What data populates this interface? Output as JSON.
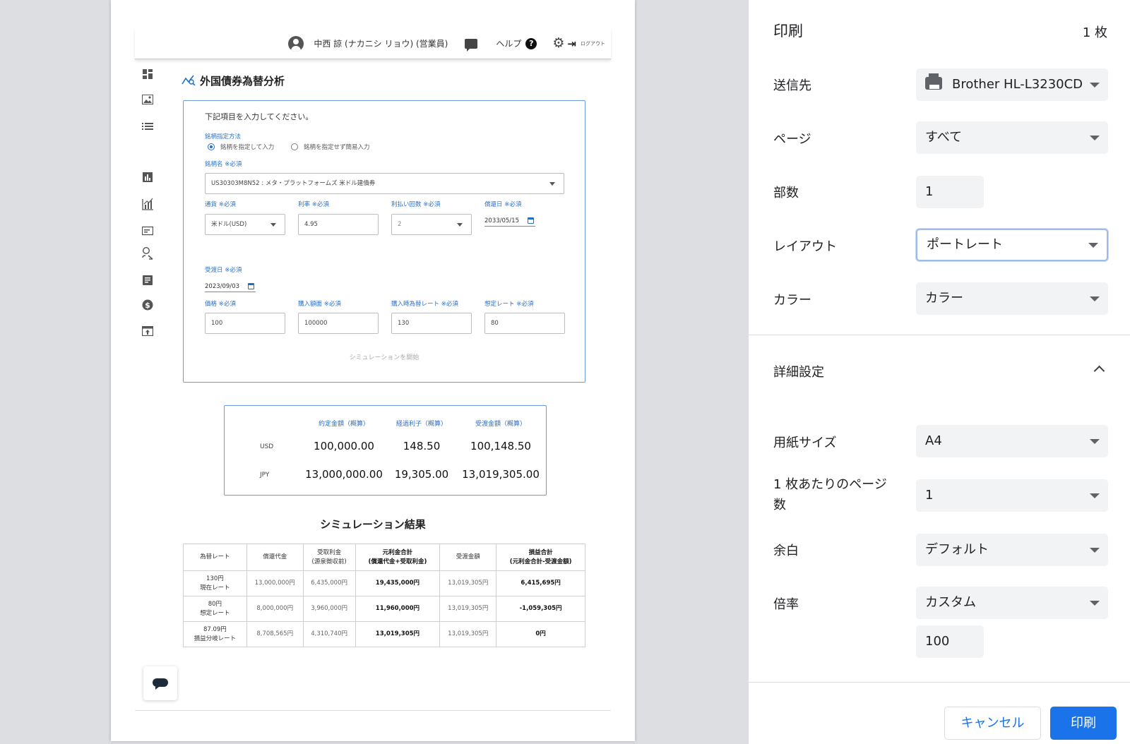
{
  "preview": {
    "topbar": {
      "username": "中西 諒 (ナカニシ リョウ) (営業員)",
      "help_label": "ヘルプ",
      "help_icon_glyph": "?",
      "logout_label": "ログアウト"
    },
    "sidebar_icons": [
      "dashboard-icon",
      "image-icon",
      "list-icon",
      "bar-chart-icon",
      "analytics-icon",
      "card-icon",
      "person-search-icon",
      "article-icon",
      "dollar-icon",
      "upload-box-icon"
    ],
    "page_title": "外国債券為替分析",
    "form": {
      "instruction": "下記項目を入力してください。",
      "method_label": "銘柄指定方法",
      "radio_1": "銘柄を指定して入力",
      "radio_2": "銘柄を指定せず簡易入力",
      "security_label": "銘柄名 ※必須",
      "security_value": "US30303M8N52 : メタ・プラットフォームズ 米ドル建債券",
      "currency_label": "通貨 ※必須",
      "currency_value": "米ドル(USD)",
      "rate_label": "利率 ※必須",
      "rate_value": "4.95",
      "payments_label": "利払い回数 ※必須",
      "payments_value": "2",
      "redemption_label": "償還日 ※必須",
      "redemption_value": "2033/05/15",
      "settlement_label": "受渡日 ※必須",
      "settlement_value": "2023/09/03",
      "price_label": "価格 ※必須",
      "price_value": "100",
      "face_label": "購入額面 ※必須",
      "face_value": "100000",
      "fx_label": "購入時為替レート ※必須",
      "fx_value": "130",
      "assumed_label": "想定レート ※必須",
      "assumed_value": "80",
      "start_button": "シミュレーションを開始"
    },
    "summary": {
      "headers": [
        "約定金額（概算）",
        "経過利子（概算）",
        "受渡金額（概算）"
      ],
      "rows": [
        {
          "label": "USD",
          "values": [
            "100,000.00",
            "148.50",
            "100,148.50"
          ]
        },
        {
          "label": "JPY",
          "values": [
            "13,000,000.00",
            "19,305.00",
            "13,019,305.00"
          ]
        }
      ]
    },
    "results_title": "シミュレーション結果",
    "results_table": {
      "headers": [
        "為替レート",
        "償還代金",
        "受取利金\n(源泉徴収前)",
        "元利金合計\n(償還代金+受取利金)",
        "受渡金額",
        "損益合計\n(元利金合計-受渡金額)"
      ],
      "rows": [
        [
          "130円\n現在レート",
          "13,000,000円",
          "6,435,000円",
          "19,435,000円",
          "13,019,305円",
          "6,415,695円"
        ],
        [
          "80円\n想定レート",
          "8,000,000円",
          "3,960,000円",
          "11,960,000円",
          "13,019,305円",
          "-1,059,305円"
        ],
        [
          "87.09円\n損益分岐レート",
          "8,708,565円",
          "4,310,740円",
          "13,019,305円",
          "13,019,305円",
          "0円"
        ]
      ]
    }
  },
  "print_dialog": {
    "title": "印刷",
    "sheet_count": "1 枚",
    "destination_label": "送信先",
    "destination_value": "Brother HL-L3230CD",
    "pages_label": "ページ",
    "pages_value": "すべて",
    "copies_label": "部数",
    "copies_value": "1",
    "layout_label": "レイアウト",
    "layout_value": "ポートレート",
    "color_label": "カラー",
    "color_value": "カラー",
    "advanced_label": "詳細設定",
    "paper_label": "用紙サイズ",
    "paper_value": "A4",
    "pages_per_sheet_label": "1 枚あたりのページ数",
    "pages_per_sheet_value": "1",
    "margins_label": "余白",
    "margins_value": "デフォルト",
    "scale_label": "倍率",
    "scale_value": "カスタム",
    "scale_custom_value": "100",
    "cancel_button": "キャンセル",
    "print_button": "印刷"
  },
  "colors": {
    "accent": "#1a73e8",
    "form_border": "#6c9bd8",
    "label_blue": "#2a6fc9",
    "backdrop": "#dcdee2"
  }
}
